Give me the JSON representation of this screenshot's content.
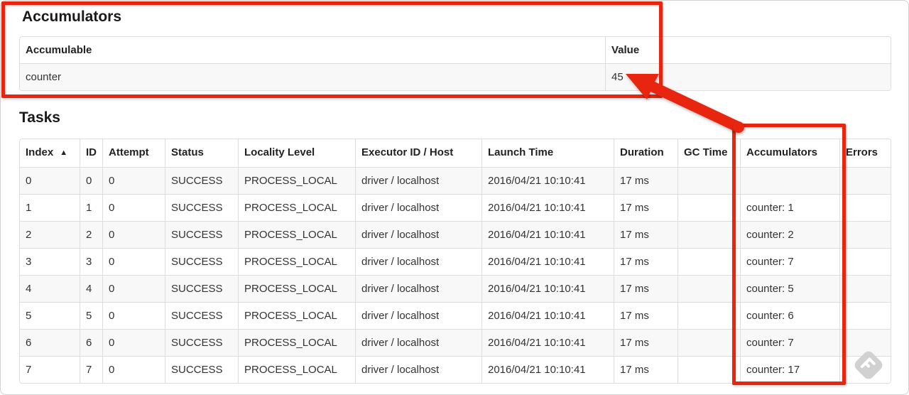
{
  "annotation_color": "#e8250f",
  "icons": {
    "sort_asc_glyph": "▲"
  },
  "accumulators_section": {
    "title": "Accumulators",
    "table": {
      "headers": [
        "Accumulable",
        "Value"
      ],
      "rows": [
        [
          "counter",
          "45"
        ]
      ]
    }
  },
  "tasks_section": {
    "title": "Tasks",
    "table": {
      "headers": [
        "Index",
        "ID",
        "Attempt",
        "Status",
        "Locality Level",
        "Executor ID / Host",
        "Launch Time",
        "Duration",
        "GC Time",
        "Accumulators",
        "Errors"
      ],
      "sorted_by": "Index",
      "sort_direction": "asc",
      "rows": [
        [
          "0",
          "0",
          "0",
          "SUCCESS",
          "PROCESS_LOCAL",
          "driver / localhost",
          "2016/04/21 10:10:41",
          "17 ms",
          "",
          "",
          ""
        ],
        [
          "1",
          "1",
          "0",
          "SUCCESS",
          "PROCESS_LOCAL",
          "driver / localhost",
          "2016/04/21 10:10:41",
          "17 ms",
          "",
          "counter: 1",
          ""
        ],
        [
          "2",
          "2",
          "0",
          "SUCCESS",
          "PROCESS_LOCAL",
          "driver / localhost",
          "2016/04/21 10:10:41",
          "17 ms",
          "",
          "counter: 2",
          ""
        ],
        [
          "3",
          "3",
          "0",
          "SUCCESS",
          "PROCESS_LOCAL",
          "driver / localhost",
          "2016/04/21 10:10:41",
          "17 ms",
          "",
          "counter: 7",
          ""
        ],
        [
          "4",
          "4",
          "0",
          "SUCCESS",
          "PROCESS_LOCAL",
          "driver / localhost",
          "2016/04/21 10:10:41",
          "17 ms",
          "",
          "counter: 5",
          ""
        ],
        [
          "5",
          "5",
          "0",
          "SUCCESS",
          "PROCESS_LOCAL",
          "driver / localhost",
          "2016/04/21 10:10:41",
          "17 ms",
          "",
          "counter: 6",
          ""
        ],
        [
          "6",
          "6",
          "0",
          "SUCCESS",
          "PROCESS_LOCAL",
          "driver / localhost",
          "2016/04/21 10:10:41",
          "17 ms",
          "",
          "counter: 7",
          ""
        ],
        [
          "7",
          "7",
          "0",
          "SUCCESS",
          "PROCESS_LOCAL",
          "driver / localhost",
          "2016/04/21 10:10:41",
          "17 ms",
          "",
          "counter: 17",
          ""
        ]
      ]
    }
  }
}
